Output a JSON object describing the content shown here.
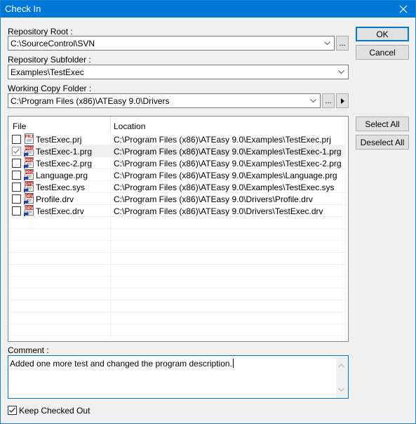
{
  "window": {
    "title": "Check In",
    "close_icon": "close-icon"
  },
  "repository_root": {
    "label": "Repository Root :",
    "value": "C:\\SourceControl\\SVN",
    "browse_label": "..."
  },
  "repository_subfolder": {
    "label": "Repository Subfolder :",
    "value": "Examples\\TestExec"
  },
  "working_copy_folder": {
    "label": "Working Copy Folder :",
    "value": "C:\\Program Files (x86)\\ATEasy 9.0\\Drivers",
    "browse_label": "...",
    "menu_icon": "triangle-right-icon"
  },
  "buttons": {
    "ok": "OK",
    "cancel": "Cancel",
    "select_all": "Select All",
    "deselect_all": "Deselect All"
  },
  "file_list": {
    "columns": [
      "File",
      "Location"
    ],
    "rows": [
      {
        "checked": false,
        "selected": false,
        "icon": "prj-file-icon",
        "icon_text": "PRJ",
        "name": "TestExec.prj",
        "location": "C:\\Program Files (x86)\\ATEasy 9.0\\Examples\\TestExec.prj"
      },
      {
        "checked": true,
        "selected": true,
        "icon": "prg-file-icon",
        "icon_text": "PRG",
        "name": "TestExec-1.prg",
        "location": "C:\\Program Files (x86)\\ATEasy 9.0\\Examples\\TestExec-1.prg"
      },
      {
        "checked": false,
        "selected": false,
        "icon": "prg-file-icon",
        "icon_text": "PRG",
        "name": "TestExec-2.prg",
        "location": "C:\\Program Files (x86)\\ATEasy 9.0\\Examples\\TestExec-2.prg"
      },
      {
        "checked": false,
        "selected": false,
        "icon": "prg-file-icon",
        "icon_text": "PRG",
        "name": "Language.prg",
        "location": "C:\\Program Files (x86)\\ATEasy 9.0\\Examples\\Language.prg"
      },
      {
        "checked": false,
        "selected": false,
        "icon": "sys-file-icon",
        "icon_text": "SYS",
        "name": "TestExec.sys",
        "location": "C:\\Program Files (x86)\\ATEasy 9.0\\Examples\\TestExec.sys"
      },
      {
        "checked": false,
        "selected": false,
        "icon": "drv-file-icon",
        "icon_text": "DRV",
        "name": "Profile.drv",
        "location": "C:\\Program Files (x86)\\ATEasy 9.0\\Drivers\\Profile.drv"
      },
      {
        "checked": false,
        "selected": false,
        "icon": "drv-file-icon",
        "icon_text": "DRV",
        "name": "TestExec.drv",
        "location": "C:\\Program Files (x86)\\ATEasy 9.0\\Drivers\\TestExec.drv"
      }
    ]
  },
  "comment": {
    "label": "Comment :",
    "value": "Added one more test and changed the program description."
  },
  "keep_checked_out": {
    "label": "Keep Checked Out",
    "checked": true
  },
  "colors": {
    "accent": "#0078d7",
    "icon_red": "#d11f1f",
    "icon_blue": "#1f3fb0"
  }
}
